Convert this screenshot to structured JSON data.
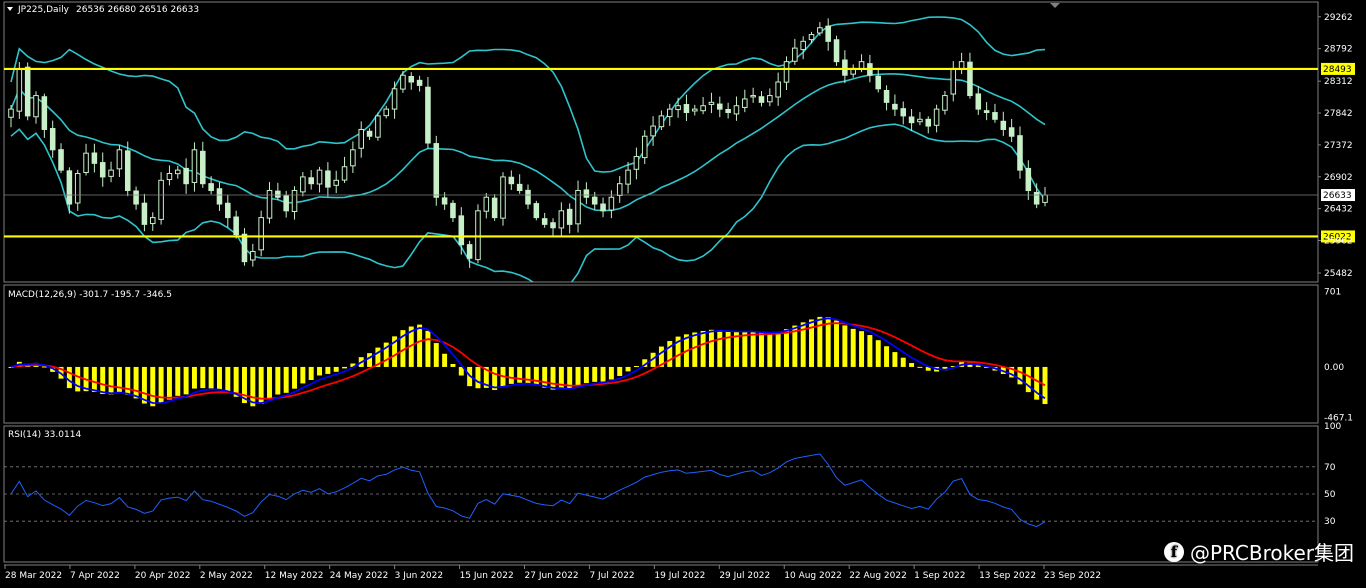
{
  "chart_data": {
    "type": "candlestick",
    "symbol_header": "JP225,Daily",
    "ohlc_header": "26536 26680 26516 26633",
    "price_axis": {
      "range": [
        25350,
        29480
      ],
      "ticks": [
        "29262",
        "28792",
        "28312",
        "27842",
        "27372",
        "26902",
        "26432",
        "25962",
        "25482"
      ]
    },
    "current_price_tag": "26633",
    "current_price": 26633,
    "horizontal_levels": [
      {
        "value": 28493,
        "label": "28493",
        "color": "#ffff00"
      },
      {
        "value": 26022,
        "label": "26022",
        "color": "#ffff00"
      }
    ],
    "date_ticks": [
      "28 Mar 2022",
      "7 Apr 2022",
      "20 Apr 2022",
      "2 May 2022",
      "12 May 2022",
      "24 May 2022",
      "3 Jun 2022",
      "15 Jun 2022",
      "27 Jun 2022",
      "7 Jul 2022",
      "19 Jul 2022",
      "29 Jul 2022",
      "10 Aug 2022",
      "22 Aug 2022",
      "1 Sep 2022",
      "13 Sep 2022",
      "23 Sep 2022"
    ],
    "close_path": [
      27900,
      28493,
      27800,
      28100,
      27600,
      27300,
      27000,
      26500,
      26950,
      27250,
      27100,
      26900,
      27000,
      27300,
      26700,
      26500,
      26200,
      26300,
      26850,
      26950,
      27000,
      26800,
      27300,
      26800,
      26700,
      26500,
      26300,
      26050,
      25650,
      25800,
      26300,
      26700,
      26600,
      26400,
      26700,
      26900,
      26800,
      27000,
      26750,
      26850,
      27050,
      27300,
      27600,
      27500,
      27800,
      27900,
      28200,
      28400,
      28300,
      28250,
      27400,
      26600,
      26500,
      26300,
      25900,
      25700,
      26400,
      26600,
      26300,
      26900,
      26800,
      26700,
      26500,
      26300,
      26200,
      26150,
      26400,
      26200,
      26700,
      26600,
      26500,
      26400,
      26600,
      26800,
      27000,
      27200,
      27500,
      27650,
      27800,
      27900,
      27950,
      27850,
      27900,
      27950,
      28000,
      27900,
      27850,
      27950,
      28050,
      28100,
      28000,
      28100,
      28300,
      28600,
      28800,
      28900,
      29000,
      29100,
      28900,
      28600,
      28400,
      28500,
      28600,
      28400,
      28200,
      28000,
      27900,
      27800,
      27700,
      27750,
      27650,
      27900,
      28100,
      28500,
      28600,
      28100,
      27900,
      27850,
      27750,
      27600,
      27500,
      27000,
      26700,
      26500,
      26633
    ],
    "macd": {
      "header": "MACD(12,26,9) -301.7 -195.7 -346.5",
      "range": [
        -520,
        760
      ],
      "ticks": [
        "701",
        "0.00",
        "-467.1"
      ],
      "histogram_color": "#ffff00",
      "macd_line_color": "#0000ff",
      "signal_line_color": "#ff0000"
    },
    "rsi": {
      "header": "RSI(14) 33.0114",
      "period": 14,
      "range": [
        0,
        100
      ],
      "ticks": [
        "100",
        "70",
        "50",
        "30"
      ],
      "levels": [
        70,
        50,
        30
      ],
      "line_color": "#2060ff"
    },
    "colors": {
      "background": "#000000",
      "candle_up": "#000000",
      "candle_down": "#c8f0c8",
      "candle_outline": "#c8f0c8",
      "bollinger": "#2ec4cc",
      "grid_line": "#808080"
    }
  },
  "watermark": {
    "icon": "facebook-icon",
    "icon_glyph": "f",
    "text": "@PRCBroker集团"
  }
}
